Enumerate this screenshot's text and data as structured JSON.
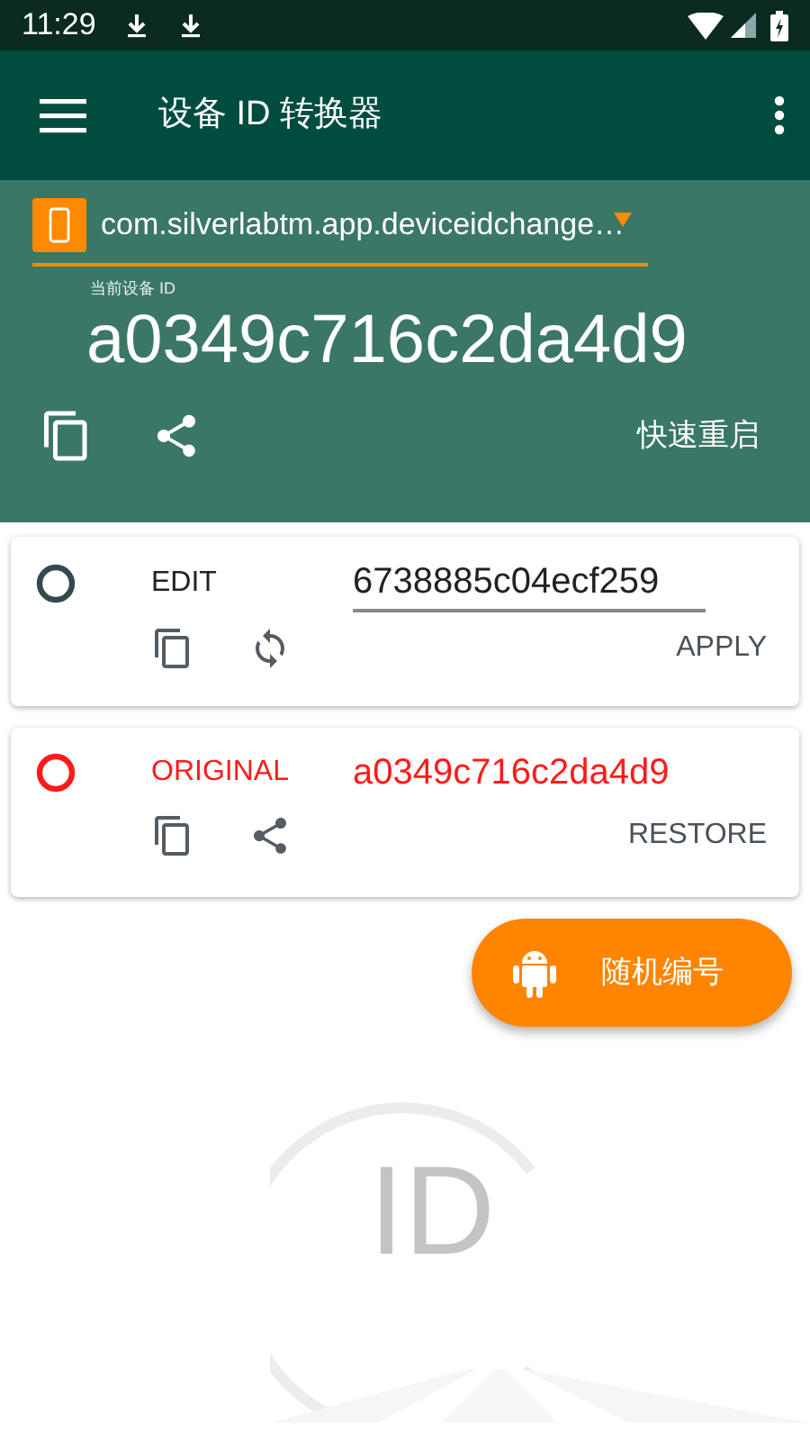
{
  "status_bar": {
    "time": "11:29"
  },
  "app_bar": {
    "title": "设备 ID 转换器"
  },
  "header": {
    "package": "com.silverlabtm.app.deviceidchange…",
    "caption": "当前设备 ID",
    "device_id": "a0349c716c2da4d9",
    "action": "快速重启"
  },
  "cards": [
    {
      "kind": "edit",
      "label": "EDIT",
      "value": "6738885c04ecf259",
      "color": "#37474f",
      "action": "APPLY"
    },
    {
      "kind": "original",
      "label": "ORIGINAL",
      "value": "a0349c716c2da4d9",
      "color": "#ff1a1a",
      "action": "RESTORE"
    }
  ],
  "fab": {
    "label": "随机编号"
  },
  "background_logo": {
    "text": "ID"
  }
}
